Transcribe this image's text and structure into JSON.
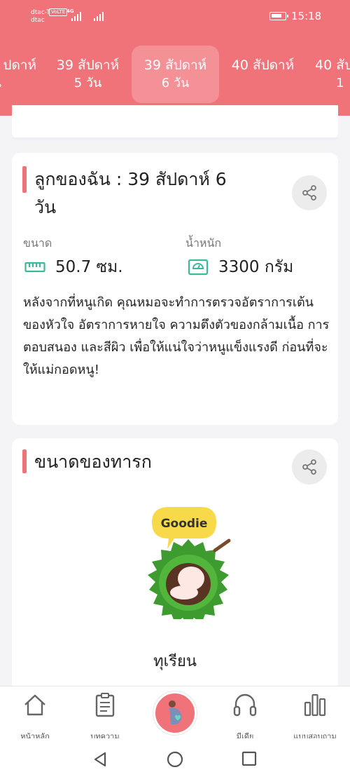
{
  "status_bar": {
    "carrier_line1": "dtac-T",
    "carrier_line2": "dtac",
    "volte": "VoLTE",
    "network": "4G",
    "time": "15:18"
  },
  "week_tabs": [
    {
      "line1": "ปดาห์",
      "line2": "วัน"
    },
    {
      "line1": "39 สัปดาห์",
      "line2": "5 วัน"
    },
    {
      "line1": "39 สัปดาห์",
      "line2": "6 วัน",
      "active": true
    },
    {
      "line1": "40 สัปดาห์",
      "line2": ""
    },
    {
      "line1": "40 สัป",
      "line2": "1"
    }
  ],
  "baby_card": {
    "title_line1": "ลูกของฉัน : 39 สัปดาห์ 6",
    "title_line2": "วัน",
    "size_label": "ขนาด",
    "size_value": "50.7 ซม.",
    "weight_label": "น้ำหนัก",
    "weight_value": "3300 กรัม",
    "description": "หลังจากที่หนูเกิด คุณหมอจะทำการตรวจอัตราการเต้นของหัวใจ อัตราการหายใจ ความตึงตัวของกล้ามเนื้อ การตอบสนอง และสีผิว เพื่อให้แน่ใจว่าหนูแข็งแรงดี ก่อนที่จะให้แม่กอดหนู!"
  },
  "size_card": {
    "title": "ขนาดของทารก",
    "badge_text": "Goodie",
    "fruit_name": "ทุเรียน"
  },
  "bottom_nav": [
    {
      "label": "หน้าหลัก",
      "icon": "home-icon"
    },
    {
      "label": "บทความ",
      "icon": "clipboard-icon"
    },
    {
      "label": "",
      "icon": "pregnancy-icon"
    },
    {
      "label": "มีเดีย",
      "icon": "headphones-icon"
    },
    {
      "label": "แบบสอบถาม",
      "icon": "bar-chart-icon"
    }
  ],
  "colors": {
    "brand": "#f0737a",
    "icon_green": "#3cb89a"
  }
}
